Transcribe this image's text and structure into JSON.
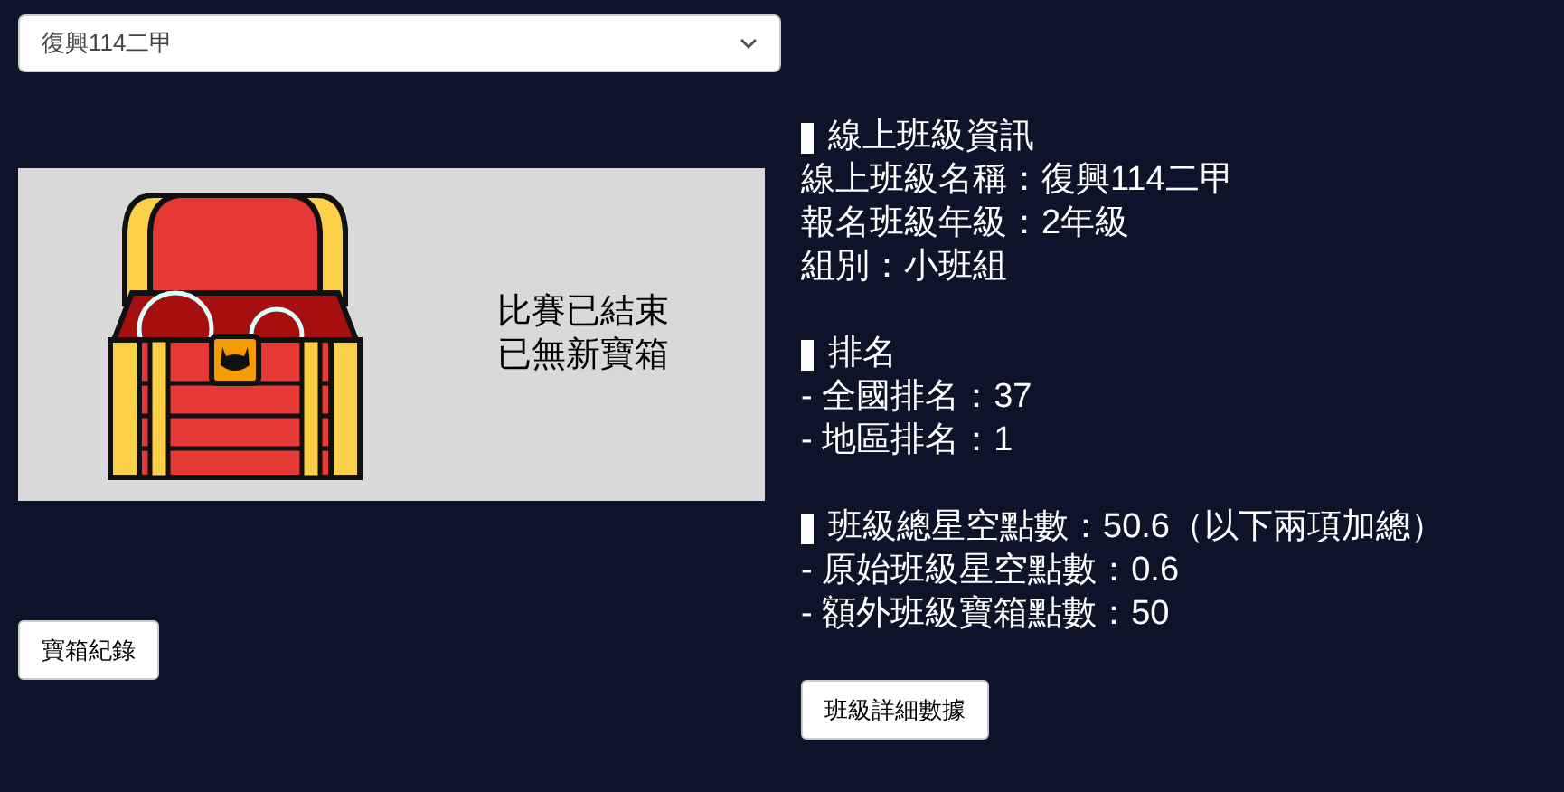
{
  "class_select": {
    "value": "復興114二甲"
  },
  "chest_panel": {
    "message_lines": [
      "比賽已結束",
      "已無新寶箱"
    ]
  },
  "chest_log_button": "寶箱紀錄",
  "sections": [
    {
      "heading": "線上班級資訊",
      "lines": [
        "線上班級名稱：復興114二甲",
        "報名班級年級：2年級",
        "組別：小班組"
      ]
    },
    {
      "heading": "排名",
      "lines": [
        "- 全國排名：37",
        "- 地區排名：1"
      ]
    },
    {
      "heading": "班級總星空點數：50.6（以下兩項加總）",
      "lines": [
        "- 原始班級星空點數：0.6",
        "- 額外班級寶箱點數：50"
      ]
    }
  ],
  "detail_button": "班級詳細數據"
}
